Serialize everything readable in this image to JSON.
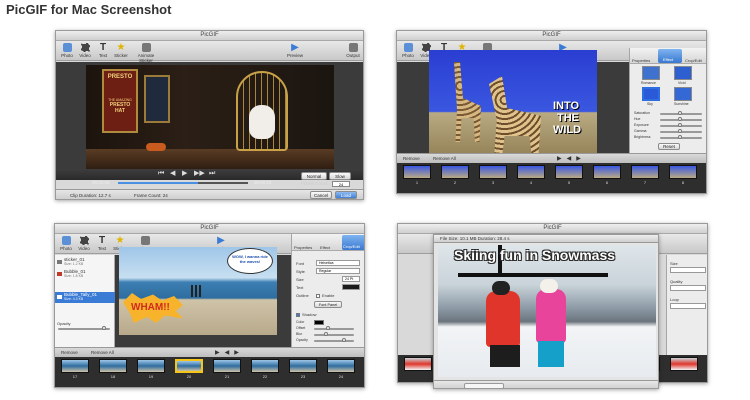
{
  "page_title": "PicGIF for Mac Screenshot",
  "windows": {
    "w1": {
      "title": "PicGIF",
      "toolbar": [
        "Photo",
        "Video",
        "Text",
        "Sticker",
        "Animate Sticker",
        "Preview",
        "Output"
      ],
      "poster_text": [
        "PRESTO",
        "THE AMAZING",
        "PRESTO",
        "HAT"
      ],
      "player_controls": [
        "⏮",
        "◀",
        "▶",
        "▶▶",
        "⏭"
      ],
      "time_start": "00:00:00",
      "time_end": "00:00:24",
      "buttons": [
        "Normal",
        "Slow",
        "Cancel",
        "Load"
      ],
      "frame_count_label": "Frame Count:",
      "frame_count": "24",
      "clip_duration": "Clip Duration: 12.7 s",
      "frame_count_footer": "Frame Count: 24"
    },
    "w2": {
      "title": "PicGIF",
      "toolbar": [
        "Photo",
        "Video",
        "Text",
        "Sticker",
        "Animate Sticker",
        "Play"
      ],
      "caption": [
        "INTO",
        "THE",
        "WILD"
      ],
      "panel_tabs": [
        "Properties",
        "Effect",
        "Crop/Edit"
      ],
      "effects": [
        "Romance",
        "Vivid",
        "Sky",
        "Sunshine"
      ],
      "adjust_labels": [
        "Saturation",
        "Hue",
        "Exposure",
        "Gamma",
        "Brightness"
      ],
      "reset_label": "Reset",
      "remove_label": "Remove",
      "remove_all_label": "Remove All",
      "frame_numbers": [
        "1",
        "2",
        "3",
        "4",
        "5",
        "6",
        "7",
        "8"
      ]
    },
    "w3": {
      "title": "PicGIF",
      "toolbar": [
        "Photo",
        "Video",
        "Text",
        "Sticker",
        "Animate Sticker",
        "Preview"
      ],
      "files": [
        {
          "name": "sticker_01",
          "size": "Size: 1.2 KB"
        },
        {
          "name": "Bubble_01",
          "size": "Size: 1.8 KB"
        },
        {
          "name": "Bubble_Tally_01",
          "size": "Size: 4.3 KB"
        }
      ],
      "bubble_text": "WOW, I wanna ride the waves!",
      "wham_text": "WHAM!!",
      "panel_tabs": [
        "Properties",
        "Effect",
        "Crop/Edit"
      ],
      "props": [
        {
          "label": "Font",
          "value": "Helvetica"
        },
        {
          "label": "Style",
          "value": "Regular"
        },
        {
          "label": "Size",
          "value": "24 Pt"
        },
        {
          "label": "Text",
          "value": ""
        }
      ],
      "outline_label": "Outline",
      "enable_label": "Enable",
      "font_panel_label": "Font Panel",
      "shadow_label": "Shadow",
      "shadow_props": [
        "Color",
        "Offset",
        "Blur",
        "Opacity"
      ],
      "opacity_label": "Opacity",
      "remove_label": "Remove",
      "remove_all_label": "Remove All",
      "frame_numbers": [
        "17",
        "18",
        "19",
        "20",
        "21",
        "22",
        "23",
        "24"
      ]
    },
    "w4": {
      "title": "PicGIF",
      "file_info": "File Size: 10.1 MB   Duration: 28.4 s",
      "caption": "Skiing fun in Snowmass",
      "side_labels": [
        "Size",
        "Quality",
        "Loop"
      ]
    }
  }
}
